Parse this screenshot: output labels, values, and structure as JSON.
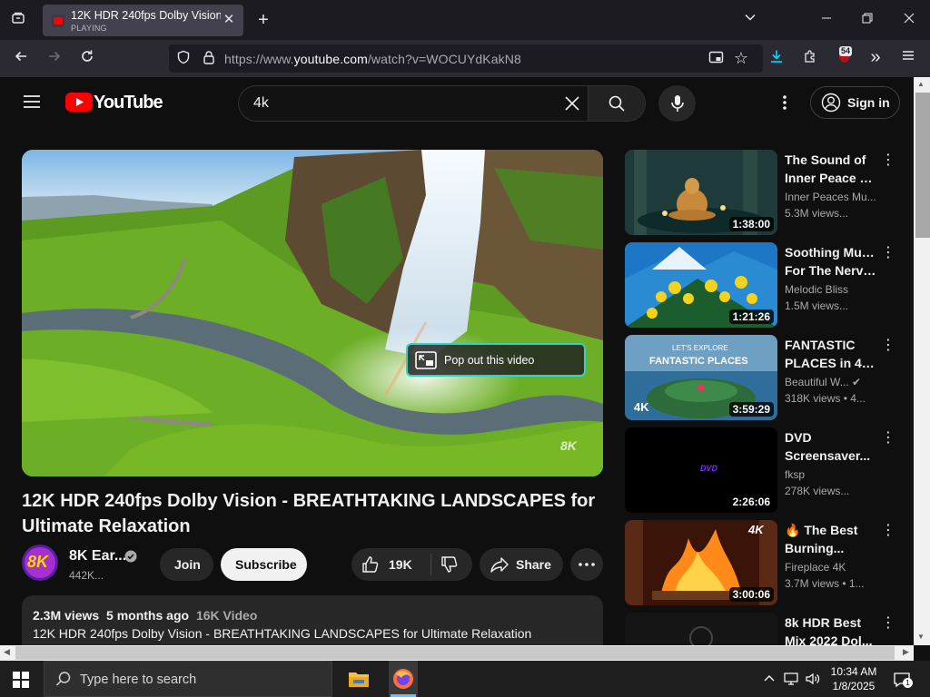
{
  "browser": {
    "tab": {
      "title": "12K HDR 240fps Dolby Vision - B",
      "status": "PLAYING"
    },
    "url": {
      "host_prefix": "https://www.",
      "host": "youtube.com",
      "path": "/watch?v=WOCUYdKakN8"
    },
    "extension_badge": "54"
  },
  "youtube": {
    "logo_text": "YouTube",
    "search": {
      "value": "4k"
    },
    "sign_in_label": "Sign in",
    "player": {
      "popout_label": "Pop out this video",
      "watermark": "8K"
    },
    "video": {
      "title": "12K HDR 240fps Dolby Vision - BREATHTAKING LANDSCAPES for Ultimate Relaxation",
      "channel_name": "8K Ear...",
      "channel_avatar_text": "8K",
      "subscribers": "442K...",
      "join_label": "Join",
      "subscribe_label": "Subscribe",
      "likes": "19K",
      "share_label": "Share"
    },
    "description": {
      "views": "2.3M views",
      "age": "5 months ago",
      "tag": "16K Video",
      "first_line": "12K HDR 240fps Dolby Vision - BREATHTAKING LANDSCAPES for Ultimate Relaxation"
    },
    "recommendations": [
      {
        "line1": "The Sound of",
        "line2": "Inner Peace 7 ...",
        "channel": "Inner Peaces Mu...",
        "views": "5.3M views...",
        "duration": "1:38:00"
      },
      {
        "line1": "Soothing Music",
        "line2": "For The Nerve...",
        "channel": "Melodic Bliss",
        "views": "1.5M views...",
        "duration": "1:21:26"
      },
      {
        "line1": "FANTASTIC",
        "line2": "PLACES in 4K...",
        "channel": "Beautiful W...",
        "views": "318K views • 4...",
        "duration": "3:59:29",
        "thumb_text": "LET'S EXPLORE",
        "thumb_title": "FANTASTIC PLACES",
        "thumb_badge": "4K"
      },
      {
        "line1": "DVD",
        "line2": "Screensaver...",
        "channel": "fksp",
        "views": "278K views...",
        "duration": "2:26:06",
        "thumb_text": "DVD"
      },
      {
        "line1": "🔥 The Best",
        "line2": "Burning...",
        "channel": "Fireplace 4K",
        "views": "3.7M views • 1...",
        "duration": "3:00:06",
        "thumb_badge": "4K"
      },
      {
        "line1": "8k HDR Best",
        "line2": "Mix 2022 Dol..."
      }
    ]
  },
  "taskbar": {
    "search_placeholder": "Type here to search",
    "time": "10:34 AM",
    "date": "1/8/2025",
    "notification_count": "1"
  },
  "colors": {
    "youtube_red": "#ff0000",
    "page_bg": "#0f0f0f",
    "popout_border": "#2fd3bf",
    "firefox_accent": "#00ddff"
  }
}
